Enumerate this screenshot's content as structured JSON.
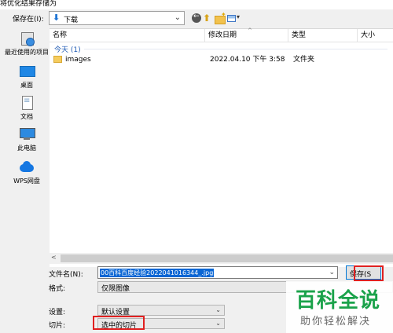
{
  "window": {
    "title": "将优化结果存储为"
  },
  "toolbar": {
    "save_in_label": "保存在(I):",
    "location": "下载",
    "back_icon": "back-arrow-icon",
    "up_icon": "up-folder-icon",
    "new_folder_icon": "new-folder-icon",
    "view_icon": "view-menu-icon"
  },
  "places": [
    {
      "label": "最近使用的项目",
      "icon": "recent-items-icon"
    },
    {
      "label": "桌面",
      "icon": "desktop-icon"
    },
    {
      "label": "文档",
      "icon": "documents-icon"
    },
    {
      "label": "此电脑",
      "icon": "computer-icon"
    },
    {
      "label": "WPS网盘",
      "icon": "cloud-drive-icon"
    }
  ],
  "columns": {
    "name": "名称",
    "date": "修改日期",
    "type": "类型",
    "size": "大小"
  },
  "group": {
    "label": "今天 (1)"
  },
  "files": [
    {
      "name": "images",
      "date": "2022.04.10 下午 3:58",
      "type": "文件夹",
      "icon": "folder-icon"
    }
  ],
  "form": {
    "filename_label": "文件名(N):",
    "filename_value": "00百科百度经验2022041016344_.jpg",
    "format_label": "格式:",
    "format_value": "仅限图像",
    "settings_label": "设置:",
    "settings_value": "默认设置",
    "slices_label": "切片:",
    "slices_value": "选中的切片",
    "save_label": "保存(S"
  },
  "watermark": {
    "title": "百科全说",
    "subtitle": "助你轻松解决"
  },
  "colors": {
    "accent": "#0078d7",
    "selection": "#0a66d4",
    "highlight_box": "#e02020",
    "watermark_green": "#1aa24a"
  }
}
